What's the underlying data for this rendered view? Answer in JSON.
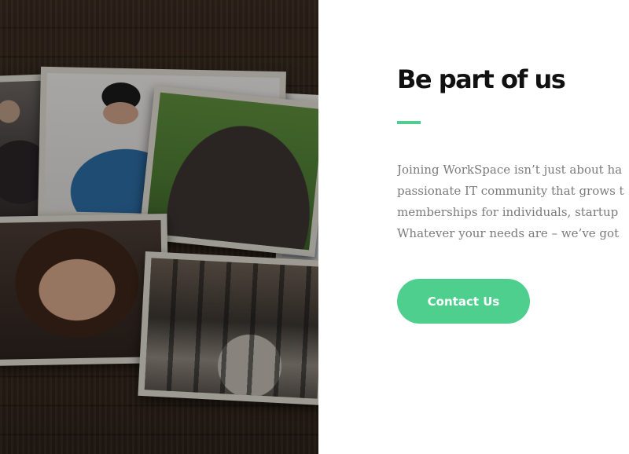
{
  "section": {
    "title": "Be part of us",
    "description_lines": [
      "Joining WorkSpace isn’t just about ha",
      "passionate IT community that grows t",
      "memberships for individuals, startup",
      "Whatever your needs are – we’ve got"
    ],
    "contact_button_label": "Contact Us"
  },
  "colors": {
    "accent": "#4fcf8e",
    "title_text": "#111111",
    "body_text": "#7b7b7b"
  }
}
